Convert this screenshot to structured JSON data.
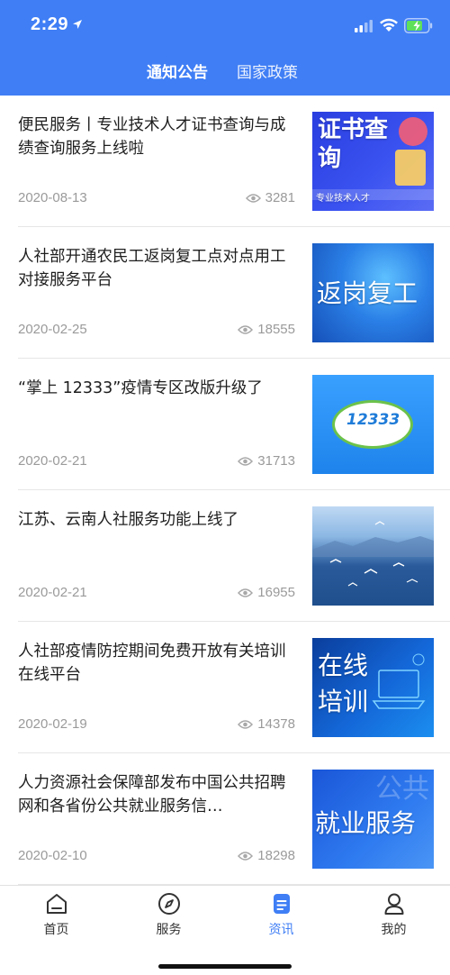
{
  "status_bar": {
    "time": "2:29"
  },
  "header": {
    "tabs": [
      {
        "label": "通知公告",
        "active": true
      },
      {
        "label": "国家政策",
        "active": false
      }
    ]
  },
  "news": [
    {
      "title": "便民服务丨专业技术人才证书查询与成绩查询服务上线啦",
      "date": "2020-08-13",
      "views": "3281",
      "thumb_text": "证书查询",
      "thumb_sub": "专业技术人才"
    },
    {
      "title": "人社部开通农民工返岗复工点对点用工对接服务平台",
      "date": "2020-02-25",
      "views": "18555",
      "thumb_text": "返岗复工"
    },
    {
      "title": "“掌上 12333”疫情专区改版升级了",
      "date": "2020-02-21",
      "views": "31713",
      "thumb_text": "12333"
    },
    {
      "title": "江苏、云南人社服务功能上线了",
      "date": "2020-02-21",
      "views": "16955"
    },
    {
      "title": "人社部疫情防控期间免费开放有关培训在线平台",
      "date": "2020-02-19",
      "views": "14378",
      "thumb_text_line1": "在线",
      "thumb_text_line2": "培训"
    },
    {
      "title": "人力资源社会保障部发布中国公共招聘网和各省份公共就业服务信…",
      "date": "2020-02-10",
      "views": "18298",
      "thumb_text": "就业服务",
      "thumb_bg_text": "公共"
    }
  ],
  "tabbar": {
    "items": [
      {
        "label": "首页",
        "icon": "home-icon",
        "active": false
      },
      {
        "label": "服务",
        "icon": "compass-icon",
        "active": false
      },
      {
        "label": "资讯",
        "icon": "document-icon",
        "active": true
      },
      {
        "label": "我的",
        "icon": "user-icon",
        "active": false
      }
    ]
  },
  "colors": {
    "brand": "#3f7ef5",
    "text": "#1e1e1e",
    "meta": "#9a9a9a"
  }
}
